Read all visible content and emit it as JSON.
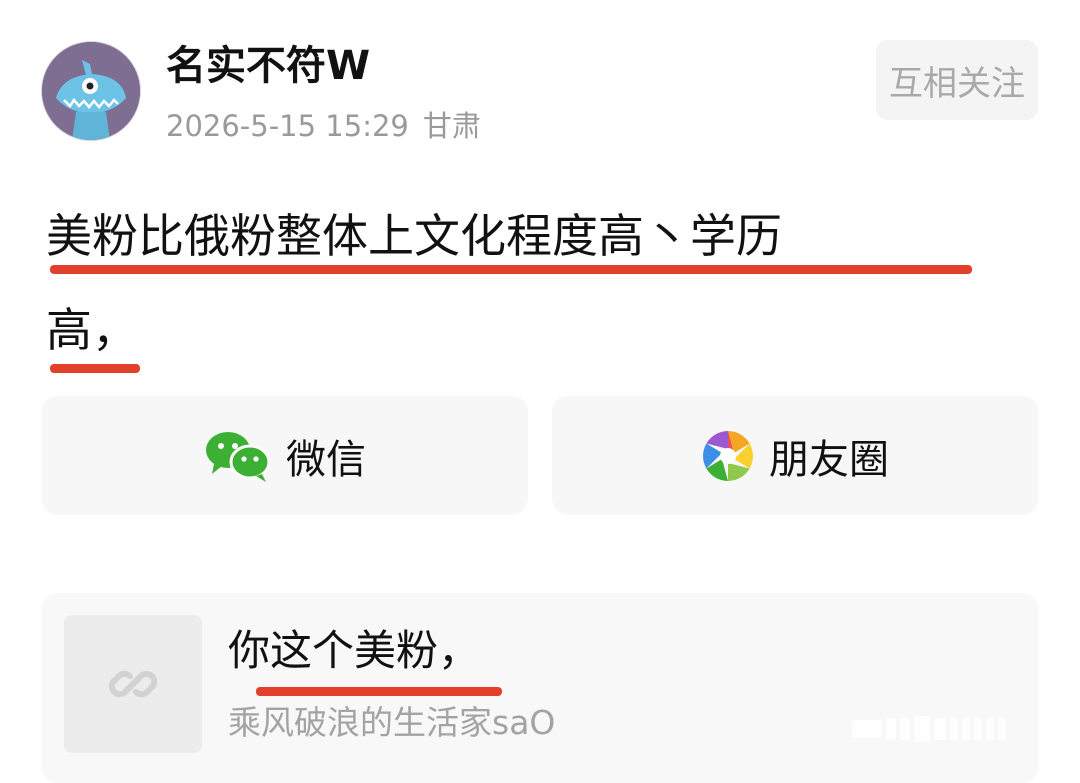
{
  "author": {
    "name": "名实不符W",
    "date": "2026-5-15 15:29",
    "location": "甘肃",
    "avatar_icon": "blue-monster-icon"
  },
  "follow_button": {
    "label": "互相关注"
  },
  "post": {
    "line1": "美粉比俄粉整体上文化程度高丶学历",
    "line2": "高，"
  },
  "share": {
    "wechat": {
      "label": "微信",
      "icon": "wechat-icon"
    },
    "moments": {
      "label": "朋友圈",
      "icon": "moments-icon"
    }
  },
  "link_card": {
    "title": "你这个美粉，",
    "source": "乘风破浪的生活家saO",
    "icon": "link-icon"
  },
  "colors": {
    "underline": "#e2402b",
    "wechat_green": "#3cb034",
    "muted_text": "#9a9a9a"
  }
}
